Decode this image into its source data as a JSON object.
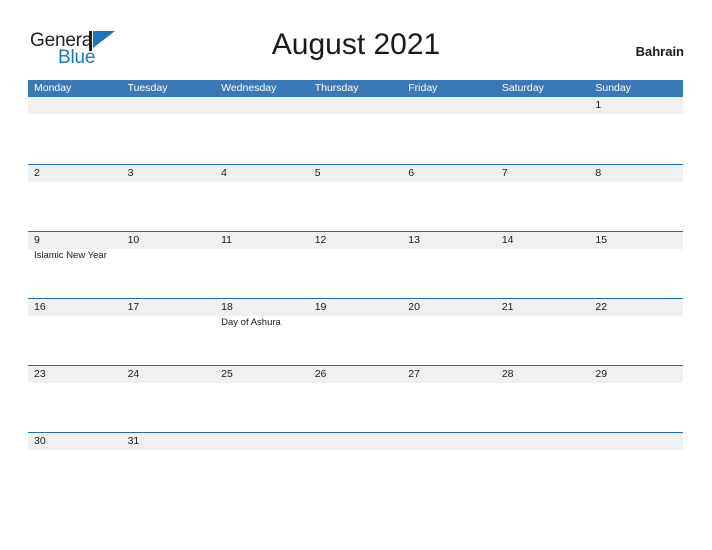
{
  "brand": {
    "name_part1": "General",
    "name_part2": "Blue",
    "flag_icon": "blue-triangle-flag-icon",
    "color_dark": "#231f20",
    "color_blue": "#1b75bb"
  },
  "header": {
    "title": "August 2021",
    "country": "Bahrain"
  },
  "theme": {
    "header_blue": "#3a79b8",
    "divider_blue": "#1f6ea8",
    "band_gray": "#f0f0f0",
    "text_dark": "#1a1a1a"
  },
  "calendar": {
    "weekdays": [
      "Monday",
      "Tuesday",
      "Wednesday",
      "Thursday",
      "Friday",
      "Saturday",
      "Sunday"
    ],
    "weeks": [
      {
        "days": [
          {
            "num": "",
            "event": ""
          },
          {
            "num": "",
            "event": ""
          },
          {
            "num": "",
            "event": ""
          },
          {
            "num": "",
            "event": ""
          },
          {
            "num": "",
            "event": ""
          },
          {
            "num": "",
            "event": ""
          },
          {
            "num": "1",
            "event": ""
          }
        ]
      },
      {
        "days": [
          {
            "num": "2",
            "event": ""
          },
          {
            "num": "3",
            "event": ""
          },
          {
            "num": "4",
            "event": ""
          },
          {
            "num": "5",
            "event": ""
          },
          {
            "num": "6",
            "event": ""
          },
          {
            "num": "7",
            "event": ""
          },
          {
            "num": "8",
            "event": ""
          }
        ]
      },
      {
        "days": [
          {
            "num": "9",
            "event": "Islamic New Year"
          },
          {
            "num": "10",
            "event": ""
          },
          {
            "num": "11",
            "event": ""
          },
          {
            "num": "12",
            "event": ""
          },
          {
            "num": "13",
            "event": ""
          },
          {
            "num": "14",
            "event": ""
          },
          {
            "num": "15",
            "event": ""
          }
        ]
      },
      {
        "days": [
          {
            "num": "16",
            "event": ""
          },
          {
            "num": "17",
            "event": ""
          },
          {
            "num": "18",
            "event": "Day of Ashura"
          },
          {
            "num": "19",
            "event": ""
          },
          {
            "num": "20",
            "event": ""
          },
          {
            "num": "21",
            "event": ""
          },
          {
            "num": "22",
            "event": ""
          }
        ]
      },
      {
        "days": [
          {
            "num": "23",
            "event": ""
          },
          {
            "num": "24",
            "event": ""
          },
          {
            "num": "25",
            "event": ""
          },
          {
            "num": "26",
            "event": ""
          },
          {
            "num": "27",
            "event": ""
          },
          {
            "num": "28",
            "event": ""
          },
          {
            "num": "29",
            "event": ""
          }
        ]
      },
      {
        "days": [
          {
            "num": "30",
            "event": ""
          },
          {
            "num": "31",
            "event": ""
          },
          {
            "num": "",
            "event": ""
          },
          {
            "num": "",
            "event": ""
          },
          {
            "num": "",
            "event": ""
          },
          {
            "num": "",
            "event": ""
          },
          {
            "num": "",
            "event": ""
          }
        ]
      }
    ]
  }
}
